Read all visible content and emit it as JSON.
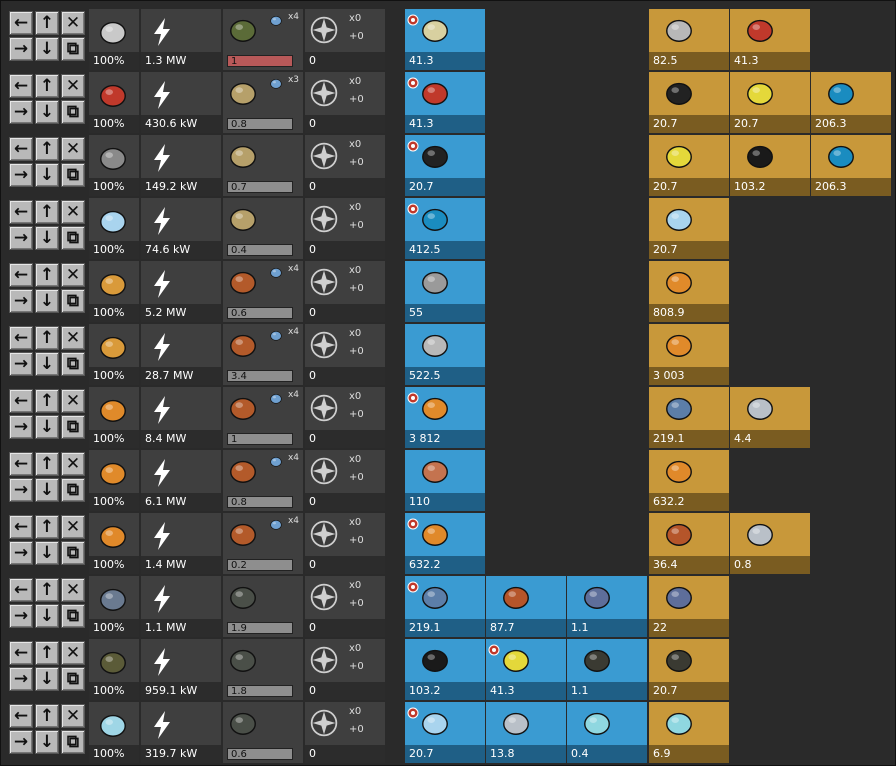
{
  "rows": [
    {
      "name": "rocket-silo-row",
      "recipe_icon": "rocket-icon",
      "recipe_pct": "100%",
      "power": "1.3 MW",
      "building_icon": "rocket-silo-icon",
      "module_count": "x4",
      "module_icon": "module-icon",
      "bar": "1",
      "bar_red": true,
      "beacon_count": "0",
      "x0": "x0",
      "plus0": "+0",
      "products": [
        {
          "icon": "rocket-part-icon",
          "value": "41.3",
          "target": true
        }
      ],
      "ingredients": [
        {
          "icon": "low-density-structure-icon",
          "value": "82.5"
        },
        {
          "icon": "rocket-fuel-icon",
          "value": "41.3"
        }
      ]
    },
    {
      "name": "rocket-fuel-row",
      "recipe_icon": "rocket-fuel-icon",
      "recipe_pct": "100%",
      "power": "430.6 kW",
      "building_icon": "chemical-plant-icon",
      "module_count": "x3",
      "module_icon": "module-icon",
      "bar": "0.8",
      "bar_red": false,
      "beacon_count": "0",
      "x0": "x0",
      "plus0": "+0",
      "products": [
        {
          "icon": "rocket-fuel-icon",
          "value": "41.3",
          "target": true
        }
      ],
      "ingredients": [
        {
          "icon": "coal-icon",
          "value": "20.7"
        },
        {
          "icon": "sulfur-icon",
          "value": "20.7"
        },
        {
          "icon": "water-icon",
          "value": "206.3"
        }
      ]
    },
    {
      "name": "coal-processing-row",
      "recipe_icon": "coal-processing-icon",
      "recipe_pct": "100%",
      "power": "149.2 kW",
      "building_icon": "chemical-plant-icon",
      "module_count": "",
      "module_icon": "",
      "bar": "0.7",
      "bar_red": false,
      "beacon_count": "0",
      "x0": "x0",
      "plus0": "+0",
      "products": [
        {
          "icon": "coal-icon",
          "value": "20.7",
          "target": true
        }
      ],
      "ingredients": [
        {
          "icon": "sulfur-icon",
          "value": "20.7"
        },
        {
          "icon": "carbon-icon",
          "value": "103.2"
        },
        {
          "icon": "water-icon",
          "value": "206.3"
        }
      ]
    },
    {
      "name": "ice-melting-row",
      "recipe_icon": "ice-icon",
      "recipe_pct": "100%",
      "power": "74.6 kW",
      "building_icon": "chemical-plant-icon",
      "module_count": "",
      "module_icon": "",
      "bar": "0.4",
      "bar_red": false,
      "beacon_count": "0",
      "x0": "x0",
      "plus0": "+0",
      "products": [
        {
          "icon": "water-icon",
          "value": "412.5",
          "target": true
        }
      ],
      "ingredients": [
        {
          "icon": "ice-icon",
          "value": "20.7"
        }
      ]
    },
    {
      "name": "steel-casting-row",
      "recipe_icon": "steel-casting-icon",
      "recipe_pct": "100%",
      "power": "5.2 MW",
      "building_icon": "foundry-icon",
      "module_count": "x4",
      "module_icon": "module-icon",
      "bar": "0.6",
      "bar_red": false,
      "beacon_count": "0",
      "x0": "x0",
      "plus0": "+0",
      "products": [
        {
          "icon": "steel-beam-icon",
          "value": "55",
          "target": false
        }
      ],
      "ingredients": [
        {
          "icon": "molten-iron-icon",
          "value": "808.9"
        }
      ]
    },
    {
      "name": "plate-casting-row",
      "recipe_icon": "plate-casting-icon",
      "recipe_pct": "100%",
      "power": "28.7 MW",
      "building_icon": "foundry-icon",
      "module_count": "x4",
      "module_icon": "module-icon",
      "bar": "3.4",
      "bar_red": false,
      "beacon_count": "0",
      "x0": "x0",
      "plus0": "+0",
      "products": [
        {
          "icon": "steel-plate-icon",
          "value": "522.5",
          "target": false
        }
      ],
      "ingredients": [
        {
          "icon": "molten-iron-icon",
          "value": "3 003"
        }
      ]
    },
    {
      "name": "molten-iron-row",
      "recipe_icon": "molten-iron-icon",
      "recipe_pct": "100%",
      "power": "8.4 MW",
      "building_icon": "foundry-icon",
      "module_count": "x4",
      "module_icon": "module-icon",
      "bar": "1",
      "bar_red": false,
      "beacon_count": "0",
      "x0": "x0",
      "plus0": "+0",
      "products": [
        {
          "icon": "molten-iron-icon",
          "value": "3 812",
          "target": true
        }
      ],
      "ingredients": [
        {
          "icon": "iron-ore-icon",
          "value": "219.1"
        },
        {
          "icon": "calcite-icon",
          "value": "4.4"
        }
      ]
    },
    {
      "name": "copper-casting-row",
      "recipe_icon": "copper-casting-icon",
      "recipe_pct": "100%",
      "power": "6.1 MW",
      "building_icon": "foundry-icon",
      "module_count": "x4",
      "module_icon": "module-icon",
      "bar": "0.8",
      "bar_red": false,
      "beacon_count": "0",
      "x0": "x0",
      "plus0": "+0",
      "products": [
        {
          "icon": "copper-plate-icon",
          "value": "110",
          "target": false
        }
      ],
      "ingredients": [
        {
          "icon": "molten-copper-icon",
          "value": "632.2"
        }
      ]
    },
    {
      "name": "molten-copper-row",
      "recipe_icon": "molten-copper-icon",
      "recipe_pct": "100%",
      "power": "1.4 MW",
      "building_icon": "foundry-icon",
      "module_count": "x4",
      "module_icon": "module-icon",
      "bar": "0.2",
      "bar_red": false,
      "beacon_count": "0",
      "x0": "x0",
      "plus0": "+0",
      "products": [
        {
          "icon": "molten-copper-icon",
          "value": "632.2",
          "target": true
        }
      ],
      "ingredients": [
        {
          "icon": "copper-ore-icon",
          "value": "36.4"
        },
        {
          "icon": "calcite-icon",
          "value": "0.8"
        }
      ]
    },
    {
      "name": "metallic-asteroid-row",
      "recipe_icon": "metallic-asteroid-icon",
      "recipe_pct": "100%",
      "power": "1.1 MW",
      "building_icon": "crusher-icon",
      "module_count": "",
      "module_icon": "",
      "bar": "1.9",
      "bar_red": false,
      "beacon_count": "0",
      "x0": "x0",
      "plus0": "+0",
      "products": [
        {
          "icon": "iron-ore-icon",
          "value": "219.1",
          "target": true
        },
        {
          "icon": "copper-ore-icon",
          "value": "87.7",
          "target": false
        },
        {
          "icon": "metallic-chunk-icon",
          "value": "1.1",
          "target": false
        }
      ],
      "ingredients": [
        {
          "icon": "metallic-chunk-icon",
          "value": "22"
        }
      ]
    },
    {
      "name": "carbonic-asteroid-row",
      "recipe_icon": "carbonic-asteroid-icon",
      "recipe_pct": "100%",
      "power": "959.1 kW",
      "building_icon": "crusher-icon",
      "module_count": "",
      "module_icon": "",
      "bar": "1.8",
      "bar_red": false,
      "beacon_count": "0",
      "x0": "x0",
      "plus0": "+0",
      "products": [
        {
          "icon": "carbon-icon",
          "value": "103.2",
          "target": false
        },
        {
          "icon": "sulfur-icon",
          "value": "41.3",
          "target": true
        },
        {
          "icon": "carbonic-chunk-icon",
          "value": "1.1",
          "target": false
        }
      ],
      "ingredients": [
        {
          "icon": "carbonic-chunk-icon",
          "value": "20.7"
        }
      ]
    },
    {
      "name": "oxide-asteroid-row",
      "recipe_icon": "oxide-asteroid-icon",
      "recipe_pct": "100%",
      "power": "319.7 kW",
      "building_icon": "crusher-icon",
      "module_count": "",
      "module_icon": "",
      "bar": "0.6",
      "bar_red": false,
      "beacon_count": "0",
      "x0": "x0",
      "plus0": "+0",
      "products": [
        {
          "icon": "ice-icon",
          "value": "20.7",
          "target": true
        },
        {
          "icon": "calcite-icon",
          "value": "13.8",
          "target": false
        },
        {
          "icon": "oxide-chunk-icon",
          "value": "0.4",
          "target": false
        }
      ],
      "ingredients": [
        {
          "icon": "oxide-chunk-icon",
          "value": "6.9"
        }
      ]
    }
  ],
  "controls": {
    "left": "←",
    "up": "↑",
    "close": "✕",
    "right": "→",
    "down": "↓",
    "copy": "⧉"
  },
  "icon_colors": {
    "rocket-icon": "#c9c9c9",
    "rocket-part-icon": "#d8d0a0",
    "rocket-fuel-icon": "#c0392b",
    "coal-icon": "#222222",
    "sulfur-icon": "#e4d83a",
    "water-icon": "#1a8cc0",
    "coal-processing-icon": "#8a8a8a",
    "ice-icon": "#a9d4ee",
    "steel-casting-icon": "#d99a3a",
    "plate-casting-icon": "#d99a3a",
    "molten-iron-icon": "#e08a2a",
    "copper-casting-icon": "#e08a2a",
    "molten-copper-icon": "#e0892a",
    "metallic-asteroid-icon": "#6a7a90",
    "carbonic-asteroid-icon": "#5b5b38",
    "oxide-asteroid-icon": "#9fd6e6",
    "iron-ore-icon": "#5c7ea8",
    "copper-ore-icon": "#b5552a",
    "metallic-chunk-icon": "#5e6e9a",
    "carbonic-chunk-icon": "#3a3a32",
    "oxide-chunk-icon": "#8fd7e0",
    "calcite-icon": "#b9c0c8",
    "carbon-icon": "#1a1a1a",
    "steel-beam-icon": "#9a9a9a",
    "steel-plate-icon": "#b8b8b8",
    "copper-plate-icon": "#c4734f",
    "low-density-structure-icon": "#b8b8b8",
    "rocket-silo-icon": "#5b6b38",
    "chemical-plant-icon": "#b6a06a",
    "foundry-icon": "#b35a2a",
    "crusher-icon": "#4a4f48",
    "module-icon": "#6fa0d0",
    "lightning-icon": "#ffffff",
    "beacon-icon": "#cfcfcf"
  }
}
